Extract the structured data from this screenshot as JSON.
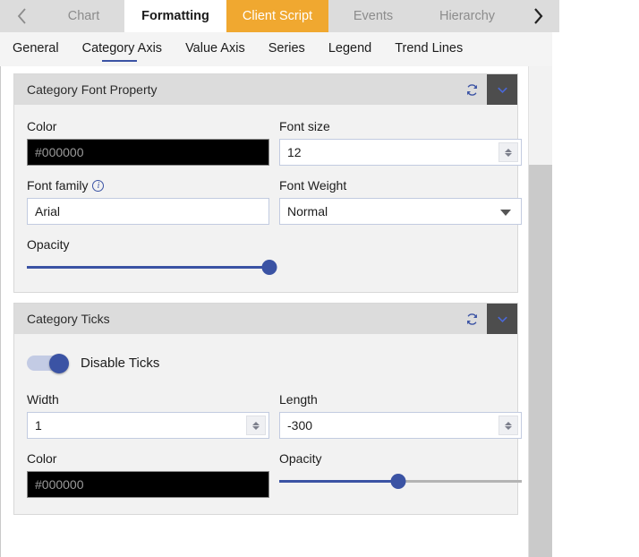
{
  "tabs": {
    "prev_icon": "chevron-left-icon",
    "next_icon": "chevron-right-icon",
    "items": [
      {
        "label": "Chart",
        "state": "inactive"
      },
      {
        "label": "Formatting",
        "state": "active"
      },
      {
        "label": "Client Script",
        "state": "highlight"
      },
      {
        "label": "Events",
        "state": "inactive"
      },
      {
        "label": "Hierarchy",
        "state": "inactive"
      }
    ]
  },
  "subnav": {
    "items": [
      {
        "label": "General",
        "selected": false
      },
      {
        "label": "Category Axis",
        "selected": true
      },
      {
        "label": "Value Axis",
        "selected": false
      },
      {
        "label": "Series",
        "selected": false
      },
      {
        "label": "Legend",
        "selected": false
      },
      {
        "label": "Trend Lines",
        "selected": false
      }
    ]
  },
  "colors": {
    "accent_blue": "#3b53a4",
    "highlight_orange": "#f0a830",
    "header_gray": "#dcdcdc",
    "collapse_button": "#4d4d4d"
  },
  "panels": [
    {
      "title": "Category Font Property",
      "refresh_icon": "refresh-icon",
      "collapse_icon": "chevron-down-icon",
      "fields": {
        "color_label": "Color",
        "color_value": "#000000",
        "font_size_label": "Font size",
        "font_size_value": "12",
        "font_family_label": "Font family",
        "font_family_info_icon": "info-icon",
        "font_family_value": "Arial",
        "font_weight_label": "Font Weight",
        "font_weight_value": "Normal",
        "opacity_label": "Opacity",
        "opacity_percent": 100
      }
    },
    {
      "title": "Category Ticks",
      "refresh_icon": "refresh-icon",
      "collapse_icon": "chevron-down-icon",
      "fields": {
        "toggle_label": "Disable Ticks",
        "toggle_on": true,
        "width_label": "Width",
        "width_value": "1",
        "length_label": "Length",
        "length_value": "-300",
        "color_label": "Color",
        "color_value": "#000000",
        "opacity_label": "Opacity",
        "opacity_percent": 49
      }
    }
  ],
  "scrollbar": {
    "up_arrow_icon": "chevron-up-icon"
  }
}
